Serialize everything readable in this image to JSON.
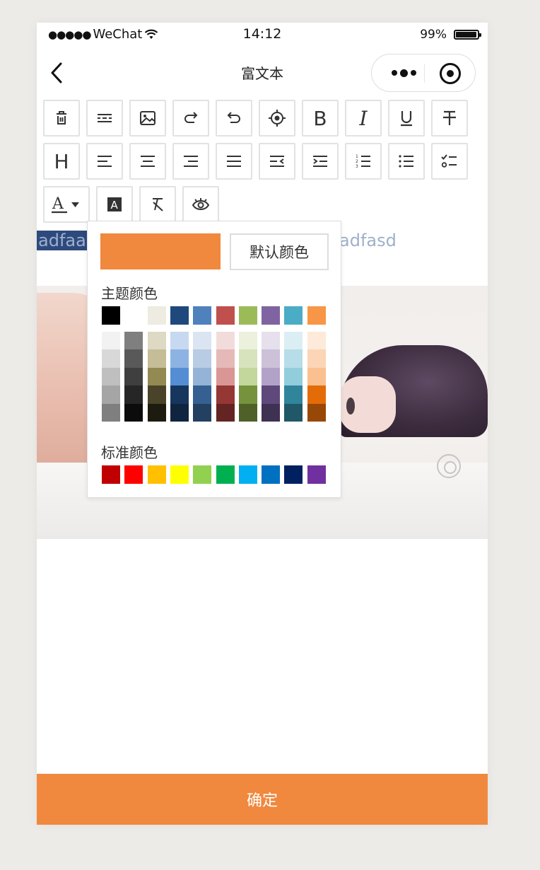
{
  "status_bar": {
    "signal_dots": "●●●●●",
    "carrier": "WeChat",
    "time": "14:12",
    "battery": "99%"
  },
  "nav": {
    "title": "富文本",
    "more_icon": "more-dots-icon",
    "close_icon": "target-circle-icon"
  },
  "toolbar": {
    "row1": [
      {
        "name": "delete-icon",
        "kind": "svg"
      },
      {
        "name": "divider-icon",
        "kind": "svg"
      },
      {
        "name": "image-icon",
        "kind": "svg"
      },
      {
        "name": "redo-icon",
        "kind": "svg"
      },
      {
        "name": "undo-icon",
        "kind": "svg"
      },
      {
        "name": "locate-icon",
        "kind": "svg"
      },
      {
        "name": "bold-icon",
        "kind": "text",
        "text": "B"
      },
      {
        "name": "italic-icon",
        "kind": "text",
        "text": "I"
      },
      {
        "name": "underline-icon",
        "kind": "svg"
      },
      {
        "name": "strikethrough-icon",
        "kind": "svg"
      }
    ],
    "row2": [
      {
        "name": "header-icon",
        "kind": "text",
        "text": "H"
      },
      {
        "name": "align-left-icon",
        "kind": "svg"
      },
      {
        "name": "align-center-icon",
        "kind": "svg"
      },
      {
        "name": "align-right-icon",
        "kind": "svg"
      },
      {
        "name": "align-justify-icon",
        "kind": "svg"
      },
      {
        "name": "outdent-icon",
        "kind": "svg"
      },
      {
        "name": "indent-icon",
        "kind": "svg"
      },
      {
        "name": "ordered-list-icon",
        "kind": "svg"
      },
      {
        "name": "bullet-list-icon",
        "kind": "svg"
      },
      {
        "name": "checklist-icon",
        "kind": "svg"
      }
    ],
    "row3": [
      {
        "name": "font-color-icon",
        "kind": "svg"
      },
      {
        "name": "background-color-icon",
        "kind": "svg"
      },
      {
        "name": "clear-format-icon",
        "kind": "svg"
      },
      {
        "name": "preview-eye-icon",
        "kind": "svg"
      }
    ]
  },
  "editor": {
    "selected_text": "adfaadfasd",
    "trailing_text": "adfasd"
  },
  "color_picker": {
    "current_color": "#F0883E",
    "default_button": "默认颜色",
    "theme_label": "主题颜色",
    "standard_label": "标准颜色",
    "theme_top": [
      "#000000",
      "#FFFFFF",
      "#EEECE1",
      "#1F497D",
      "#4F81BD",
      "#C0504D",
      "#9BBB59",
      "#8064A2",
      "#4BACC6",
      "#F79646"
    ],
    "theme_shades": [
      [
        "#F2F2F2",
        "#D8D8D8",
        "#BFBFBF",
        "#A5A5A5",
        "#7F7F7F"
      ],
      [
        "#7F7F7F",
        "#595959",
        "#3F3F3F",
        "#262626",
        "#0C0C0C"
      ],
      [
        "#DDD9C3",
        "#C4BD97",
        "#938953",
        "#494429",
        "#1D1B10"
      ],
      [
        "#C6D9F0",
        "#8DB3E2",
        "#548DD4",
        "#17365D",
        "#0F243E"
      ],
      [
        "#DBE5F1",
        "#B8CCE4",
        "#95B3D7",
        "#366092",
        "#244061"
      ],
      [
        "#F2DCDB",
        "#E5B9B7",
        "#D99694",
        "#953734",
        "#632423"
      ],
      [
        "#EBF1DD",
        "#D7E3BC",
        "#C3D69B",
        "#76923C",
        "#4F6128"
      ],
      [
        "#E5E0EC",
        "#CCC1D9",
        "#B2A2C7",
        "#5F497A",
        "#3F3151"
      ],
      [
        "#DBEEF3",
        "#B7DDE8",
        "#92CDDC",
        "#31859B",
        "#205867"
      ],
      [
        "#FDEADA",
        "#FBD5B5",
        "#FAC08F",
        "#E36C09",
        "#974806"
      ]
    ],
    "standard": [
      "#C00000",
      "#FF0000",
      "#FFC000",
      "#FFFF00",
      "#92D050",
      "#00B050",
      "#00B0F0",
      "#0070C0",
      "#002060",
      "#7030A0"
    ]
  },
  "confirm_button": "确定"
}
